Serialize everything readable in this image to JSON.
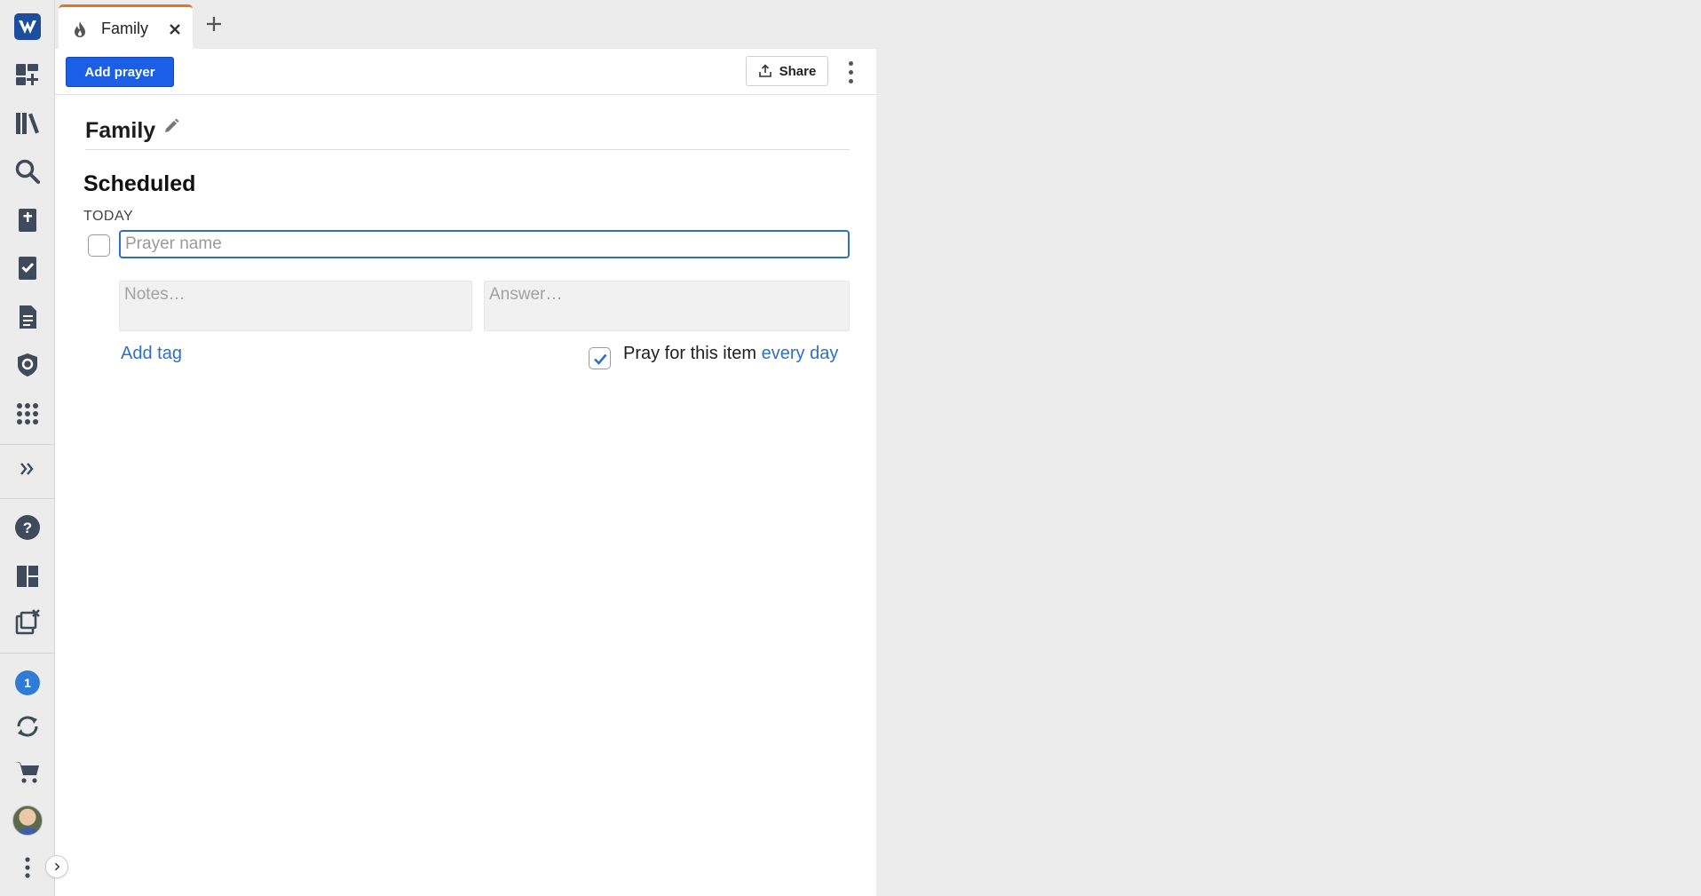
{
  "rail": {
    "logo": "app-logo",
    "items_top": [
      "add-panel-icon",
      "library-icon",
      "search-icon",
      "bible-icon",
      "reading-plan-icon",
      "document-icon",
      "guides-icon",
      "apps-grid-icon"
    ],
    "items_bottom": [
      "help-icon",
      "layouts-icon",
      "close-panels-icon",
      "notifications-badge",
      "sync-icon",
      "cart-icon",
      "avatar",
      "more-icon"
    ],
    "notification_count": "1"
  },
  "tabs": [
    {
      "label": "Family",
      "icon": "prayer-flame-icon",
      "active": true
    }
  ],
  "toolbar": {
    "add_prayer": "Add prayer",
    "share": "Share"
  },
  "list": {
    "title": "Family"
  },
  "section": {
    "heading": "Scheduled",
    "group_label": "TODAY"
  },
  "prayer": {
    "name_placeholder": "Prayer name",
    "notes_placeholder": "Notes…",
    "answer_placeholder": "Answer…",
    "add_tag": "Add tag",
    "pray_text": "Pray for this item",
    "frequency": "every day",
    "pray_checked": true
  },
  "colors": {
    "accent": "#1a5fe6",
    "link": "#2e70c7",
    "tab_indicator": "#e3771f",
    "badge": "#2e7cd6"
  }
}
